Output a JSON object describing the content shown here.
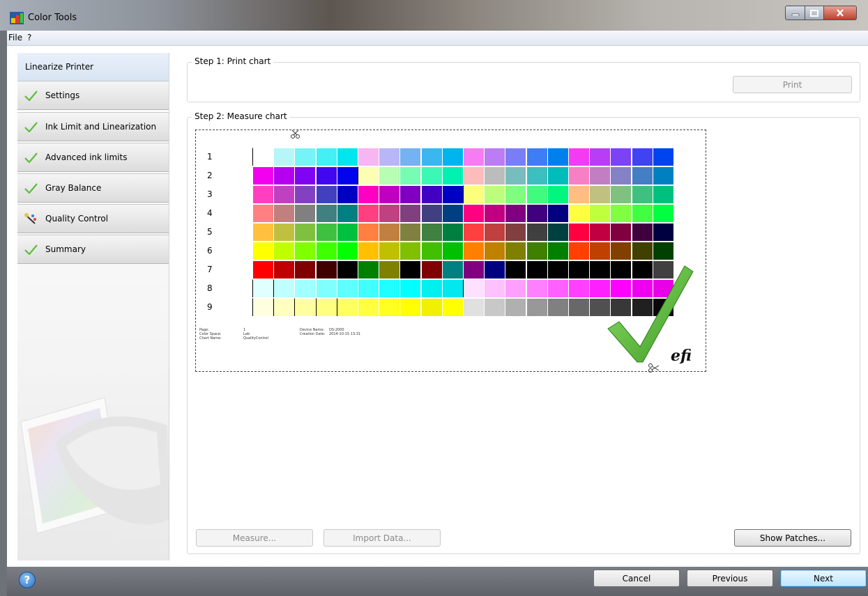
{
  "window": {
    "title": "Color Tools"
  },
  "menu": {
    "file": "File",
    "help": "?"
  },
  "sidebar": {
    "header": "Linearize Printer",
    "items": [
      {
        "label": "Settings",
        "icon": "checkmark-icon"
      },
      {
        "label": "Ink Limit and Linearization",
        "icon": "checkmark-icon"
      },
      {
        "label": "Advanced ink limits",
        "icon": "checkmark-icon"
      },
      {
        "label": "Gray Balance",
        "icon": "checkmark-icon"
      },
      {
        "label": "Quality Control",
        "icon": "quality-control-icon"
      },
      {
        "label": "Summary",
        "icon": "checkmark-icon"
      }
    ]
  },
  "step1": {
    "legend": "Step 1: Print chart",
    "print_label": "Print"
  },
  "step2": {
    "legend": "Step 2: Measure chart",
    "row_labels": [
      "1",
      "2",
      "3",
      "4",
      "5",
      "6",
      "7",
      "8",
      "9"
    ],
    "info": {
      "left_labels": "Page:\nColor Space:\nChart Name:",
      "left_values": "1\nLab\nQualityControl",
      "right_labels": "Device Name:\nCreation Date:",
      "right_values": "DS-2000\n2014-10-15 13:31"
    },
    "brand": "efi",
    "measure_label": "Measure...",
    "import_label": "Import Data...",
    "show_patches_label": "Show Patches..."
  },
  "footer": {
    "cancel_label": "Cancel",
    "previous_label": "Previous",
    "next_label": "Next",
    "help_glyph": "?"
  },
  "colors": {
    "check_green": "#5cbd3a",
    "primary_button": "#bee6fd",
    "patches": [
      [
        "#ffffff",
        "#b6f6f9",
        "#76f3f6",
        "#44f0f4",
        "#00e5ee",
        "#f5b6f2",
        "#b8b6f7",
        "#74b2f4",
        "#3ab6f0",
        "#00b4ee",
        "#f67cf3",
        "#bb7cf4",
        "#7a7ef6",
        "#3e7ef4",
        "#0080ec",
        "#f33bf1",
        "#b83df4",
        "#7c42f6",
        "#3f43f2",
        "#0044f0"
      ],
      [
        "#f200ef",
        "#b500f0",
        "#7e04f2",
        "#4107f0",
        "#0004ed",
        "#fdfdb4",
        "#b8fdb4",
        "#77fcb4",
        "#3bf8b4",
        "#00f2b2",
        "#fbbcbb",
        "#bcbcbc",
        "#78bdbd",
        "#3cbfbe",
        "#00bdbb",
        "#f680c4",
        "#c27ec2",
        "#8482c5",
        "#447fc3",
        "#0080c1"
      ],
      [
        "#ff3fc0",
        "#bf40c0",
        "#8141c1",
        "#4340c0",
        "#0001c0",
        "#ff00c2",
        "#c000c0",
        "#8000c2",
        "#4200c2",
        "#0000c2",
        "#fdfd7e",
        "#bdfd7e",
        "#80fc7e",
        "#40fb7e",
        "#00f67e",
        "#ffbe80",
        "#c0c080",
        "#80c080",
        "#40c080",
        "#00c080"
      ],
      [
        "#ff8080",
        "#c08080",
        "#808080",
        "#408080",
        "#008080",
        "#ff4080",
        "#c04080",
        "#804080",
        "#404080",
        "#004080",
        "#ff0080",
        "#c00080",
        "#800080",
        "#400080",
        "#000080",
        "#ffff40",
        "#c0ff40",
        "#80ff40",
        "#40ff40",
        "#00ff40"
      ],
      [
        "#ffc040",
        "#c0c040",
        "#80c040",
        "#40c040",
        "#00c040",
        "#ff8040",
        "#c08040",
        "#808040",
        "#408040",
        "#008040",
        "#ff4040",
        "#c04040",
        "#804040",
        "#404040",
        "#004040",
        "#ff0040",
        "#c00040",
        "#800040",
        "#400040",
        "#000040"
      ],
      [
        "#ffff00",
        "#c0ff00",
        "#80ff00",
        "#40ff00",
        "#00ff00",
        "#ffc000",
        "#c0c000",
        "#80c000",
        "#40c000",
        "#00c000",
        "#ff8000",
        "#c08000",
        "#808000",
        "#408000",
        "#008000",
        "#ff4000",
        "#c04000",
        "#804000",
        "#404000",
        "#004000"
      ],
      [
        "#ff0000",
        "#c00000",
        "#800000",
        "#400000",
        "#000000",
        "#008000",
        "#808000",
        "#000000",
        "#800000",
        "#008080",
        "#800080",
        "#000080",
        "#000000",
        "#000000",
        "#000000",
        "#000000",
        "#000000",
        "#000000",
        "#000000",
        "#404040"
      ],
      [
        "#e0ffff",
        "#c0ffff",
        "#a0ffff",
        "#80ffff",
        "#60ffff",
        "#40ffff",
        "#20ffff",
        "#00ffff",
        "#00f0f0",
        "#00e8f0",
        "#ffe0ff",
        "#ffc0ff",
        "#ffa0ff",
        "#ff80ff",
        "#ff60ff",
        "#ff40ff",
        "#ff20ff",
        "#ff00ff",
        "#f000f0",
        "#e800e8"
      ],
      [
        "#ffffe0",
        "#ffffc0",
        "#ffffa0",
        "#ffff80",
        "#ffff60",
        "#ffff40",
        "#ffff20",
        "#ffff00",
        "#f0f000",
        "#ffff00",
        "#e0e0e0",
        "#c8c8c8",
        "#b0b0b0",
        "#989898",
        "#808080",
        "#686868",
        "#505050",
        "#383838",
        "#202020",
        "#080808"
      ]
    ]
  }
}
